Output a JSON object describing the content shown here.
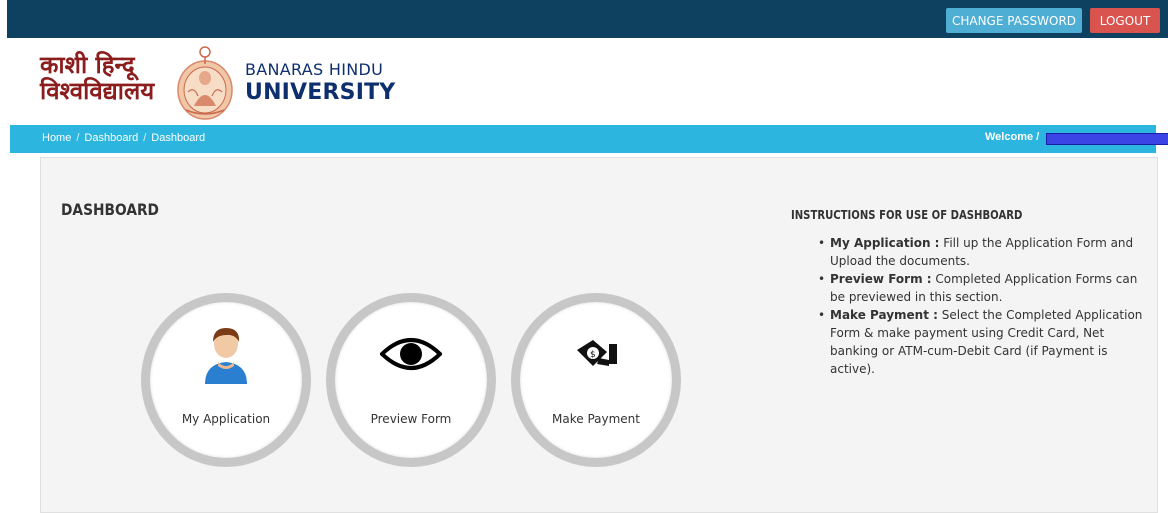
{
  "topbar": {
    "change_password": "CHANGE PASSWORD",
    "logout": "LOGOUT"
  },
  "header": {
    "hindi_line1": "काशी हिन्दू",
    "hindi_line2": "विश्वविद्यालय",
    "eng_line1": "BANARAS HINDU",
    "eng_line2": "UNIVERSITY"
  },
  "breadcrumb": [
    "Home",
    "Dashboard",
    "Dashboard"
  ],
  "breadcrumb_sep": "/",
  "welcome": {
    "label": "Welcome /",
    "suffix": "/"
  },
  "dashboard": {
    "title": "DASHBOARD",
    "tiles": [
      {
        "label": "My Application",
        "icon": "user-icon"
      },
      {
        "label": "Preview Form",
        "icon": "eye-icon"
      },
      {
        "label": "Make Payment",
        "icon": "payment-icon"
      }
    ]
  },
  "instructions": {
    "title": "INSTRUCTIONS FOR USE OF DASHBOARD",
    "items": [
      {
        "term": "My Application :",
        "text": " Fill up the Application Form and Upload the documents."
      },
      {
        "term": "Preview Form :",
        "text": " Completed Application Forms can be previewed in this section."
      },
      {
        "term": "Make Payment :",
        "text": " Select the Completed Application Form & make payment using Credit Card, Net banking or ATM-cum-Debit Card (if Payment is active)."
      }
    ]
  },
  "colors": {
    "topbar": "#0e4060",
    "breadcrumb_bar": "#2cb5df",
    "change_btn": "#4eaed4",
    "logout_btn": "#d9534f",
    "university_blue": "#0e2f6e",
    "hindi_red": "#8b1d1d"
  }
}
